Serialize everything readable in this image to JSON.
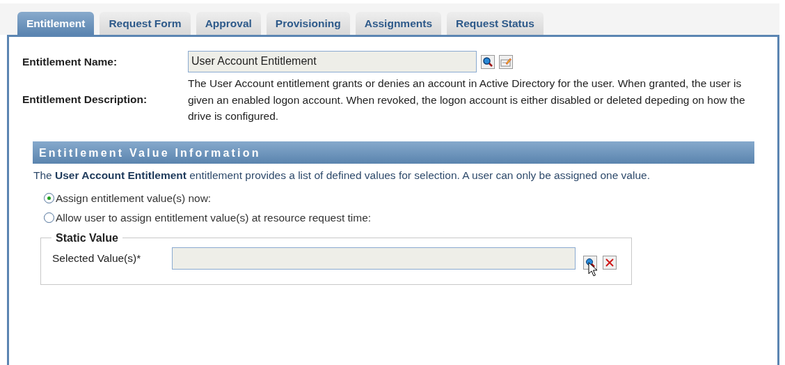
{
  "tabs": [
    {
      "label": "Entitlement",
      "selected": true
    },
    {
      "label": "Request Form",
      "selected": false
    },
    {
      "label": "Approval",
      "selected": false
    },
    {
      "label": "Provisioning",
      "selected": false
    },
    {
      "label": "Assignments",
      "selected": false
    },
    {
      "label": "Request Status",
      "selected": false
    }
  ],
  "entitlement": {
    "name_label": "Entitlement Name:",
    "name_value": "User Account Entitlement",
    "description_label": "Entitlement Description:",
    "description": "The User Account entitlement grants or denies an account in Active Directory for the user. When granted, the user is given an enabled logon account. When revoked, the logon account is either disabled or deleted depeding on how the drive is configured."
  },
  "value_section": {
    "title": "Entitlement Value Information",
    "intro": "The **User Account Entitlement** entitlement provides a list of defined values for selection. A user can only be assigned one value.",
    "options": [
      {
        "label": "Assign entitlement value(s) now:",
        "selected": true
      },
      {
        "label": "Allow user to assign entitlement value(s) at resource request time:",
        "selected": false
      }
    ],
    "static_value": {
      "legend": "Static Value",
      "field_label": "Selected Value(s)*"
    }
  }
}
